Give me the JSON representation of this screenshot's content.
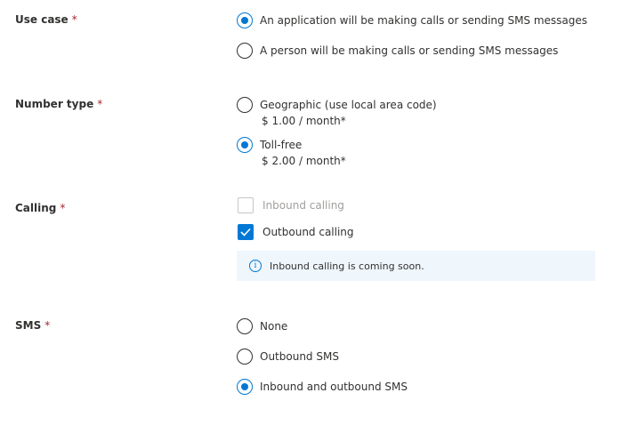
{
  "use_case": {
    "label": "Use case",
    "required_mark": "*",
    "options": [
      {
        "label": "An application will be making calls or sending SMS messages",
        "checked": true
      },
      {
        "label": "A person will be making calls or sending SMS messages",
        "checked": false
      }
    ]
  },
  "number_type": {
    "label": "Number type",
    "required_mark": "*",
    "options": [
      {
        "label": "Geographic (use local area code)",
        "price": "$ 1.00 / month*",
        "checked": false
      },
      {
        "label": "Toll-free",
        "price": "$ 2.00 / month*",
        "checked": true
      }
    ]
  },
  "calling": {
    "label": "Calling",
    "required_mark": "*",
    "options": [
      {
        "label": "Inbound calling",
        "checked": false,
        "disabled": true
      },
      {
        "label": "Outbound calling",
        "checked": true,
        "disabled": false
      }
    ],
    "info": {
      "icon": "info-icon",
      "glyph": "i",
      "text": "Inbound calling is coming soon."
    }
  },
  "sms": {
    "label": "SMS",
    "required_mark": "*",
    "options": [
      {
        "label": "None",
        "checked": false
      },
      {
        "label": "Outbound SMS",
        "checked": false
      },
      {
        "label": "Inbound and outbound SMS",
        "checked": true
      }
    ]
  },
  "colors": {
    "accent": "#0078d4",
    "required": "#a4262c",
    "info_background": "#eff6fc",
    "disabled_text": "#a19f9d"
  }
}
